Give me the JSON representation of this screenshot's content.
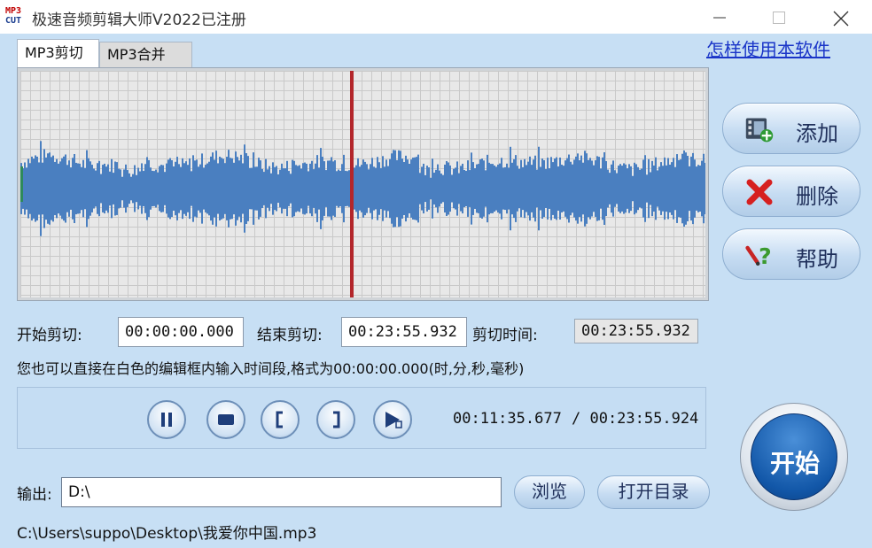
{
  "window": {
    "title": "极速音频剪辑大师V2022已注册",
    "icon_text_top": "MP3",
    "icon_text_bottom": "CUT"
  },
  "tabs": [
    {
      "label": "MP3剪切",
      "active": true
    },
    {
      "label": "MP3合并",
      "active": false
    }
  ],
  "help_link": "怎样使用本软件",
  "side_buttons": {
    "add": {
      "label": "添加",
      "icon": "film-add-icon"
    },
    "delete": {
      "label": "删除",
      "icon": "red-x-icon"
    },
    "help": {
      "label": "帮助",
      "icon": "help-question-icon"
    }
  },
  "cut": {
    "start_label": "开始剪切:",
    "start_value": "00:00:00.000",
    "end_label": "结束剪切:",
    "end_value": "00:23:55.932",
    "duration_label": "剪切时间:",
    "duration_value": "00:23:55.932"
  },
  "hint": "您也可以直接在白色的编辑框内输入时间段,格式为00:00:00.000(时,分,秒,毫秒)",
  "playback": {
    "current_time": "00:11:35.677",
    "total_time": "/ 00:23:55.924",
    "playhead_fraction": 0.484
  },
  "start_button": "开始",
  "output": {
    "label": "输出:",
    "value": "D:\\",
    "browse_label": "浏览",
    "open_dir_label": "打开目录"
  },
  "status_path": "C:\\Users\\suppo\\Desktop\\我爱你中国.mp3",
  "colors": {
    "window_bg": "#c7dff4",
    "waveform": "#4a7fc0",
    "playhead": "#b3262b",
    "link": "#1a35c8"
  }
}
